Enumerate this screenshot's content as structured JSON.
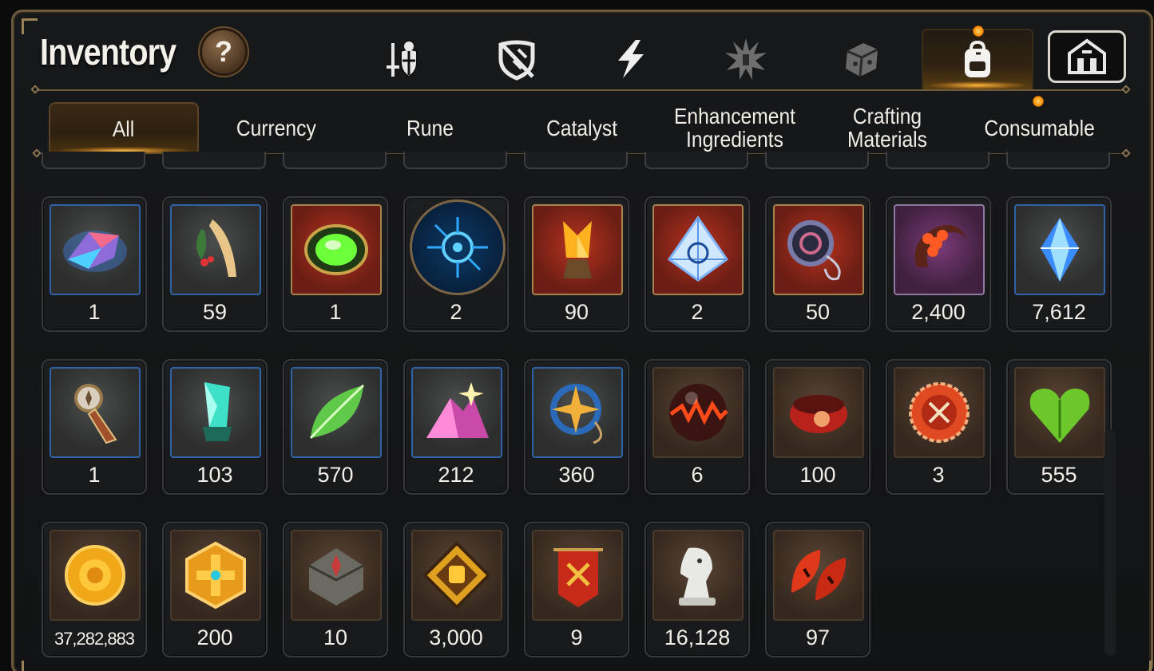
{
  "header": {
    "title": "Inventory",
    "help_label": "?"
  },
  "top_tabs": [
    {
      "icon": "sword-shield-icon"
    },
    {
      "icon": "broken-shield-icon"
    },
    {
      "icon": "lightning-icon"
    },
    {
      "icon": "burst-icon"
    },
    {
      "icon": "dice-box-icon"
    },
    {
      "icon": "backpack-icon",
      "active": true
    },
    {
      "icon": "guild-castle-icon"
    }
  ],
  "sub_tabs": [
    {
      "label": "All",
      "active": true
    },
    {
      "label": "Currency"
    },
    {
      "label": "Rune"
    },
    {
      "label": "Catalyst"
    },
    {
      "label": "Enhancement Ingredients"
    },
    {
      "label": "Crafting Materials"
    },
    {
      "label": "Consumable"
    }
  ],
  "items": [
    {
      "qty": "1",
      "icon": "prism-crystal-icon"
    },
    {
      "qty": "59",
      "icon": "herb-root-icon"
    },
    {
      "qty": "1",
      "icon": "green-orb-icon"
    },
    {
      "qty": "2",
      "icon": "rune-disc-icon"
    },
    {
      "qty": "90",
      "icon": "golden-trophy-icon"
    },
    {
      "qty": "2",
      "icon": "diamond-emblem-icon"
    },
    {
      "qty": "50",
      "icon": "coiled-ring-icon"
    },
    {
      "qty": "2,400",
      "icon": "flower-ring-icon"
    },
    {
      "qty": "7,612",
      "icon": "blue-crystal-icon"
    },
    {
      "qty": "1",
      "icon": "compass-pendant-icon"
    },
    {
      "qty": "103",
      "icon": "teal-crystal-icon"
    },
    {
      "qty": "570",
      "icon": "green-leaf-icon"
    },
    {
      "qty": "212",
      "icon": "pink-ore-icon"
    },
    {
      "qty": "360",
      "icon": "star-amulet-icon"
    },
    {
      "qty": "6",
      "icon": "fire-orb-icon"
    },
    {
      "qty": "100",
      "icon": "red-bracelet-icon"
    },
    {
      "qty": "3",
      "icon": "red-badge-icon"
    },
    {
      "qty": "555",
      "icon": "green-heart-icon"
    },
    {
      "qty": "37,282,883",
      "icon": "gold-coin-icon"
    },
    {
      "qty": "200",
      "icon": "gold-hexagon-icon"
    },
    {
      "qty": "10",
      "icon": "stone-compass-icon"
    },
    {
      "qty": "3,000",
      "icon": "fist-badge-icon"
    },
    {
      "qty": "9",
      "icon": "war-banner-icon"
    },
    {
      "qty": "16,128",
      "icon": "silver-knight-icon"
    },
    {
      "qty": "97",
      "icon": "red-leaf-icon"
    }
  ],
  "colors": {
    "accent": "#ffb43a",
    "frame": "#6b5a3d",
    "rare_border": "#2f63a8"
  }
}
